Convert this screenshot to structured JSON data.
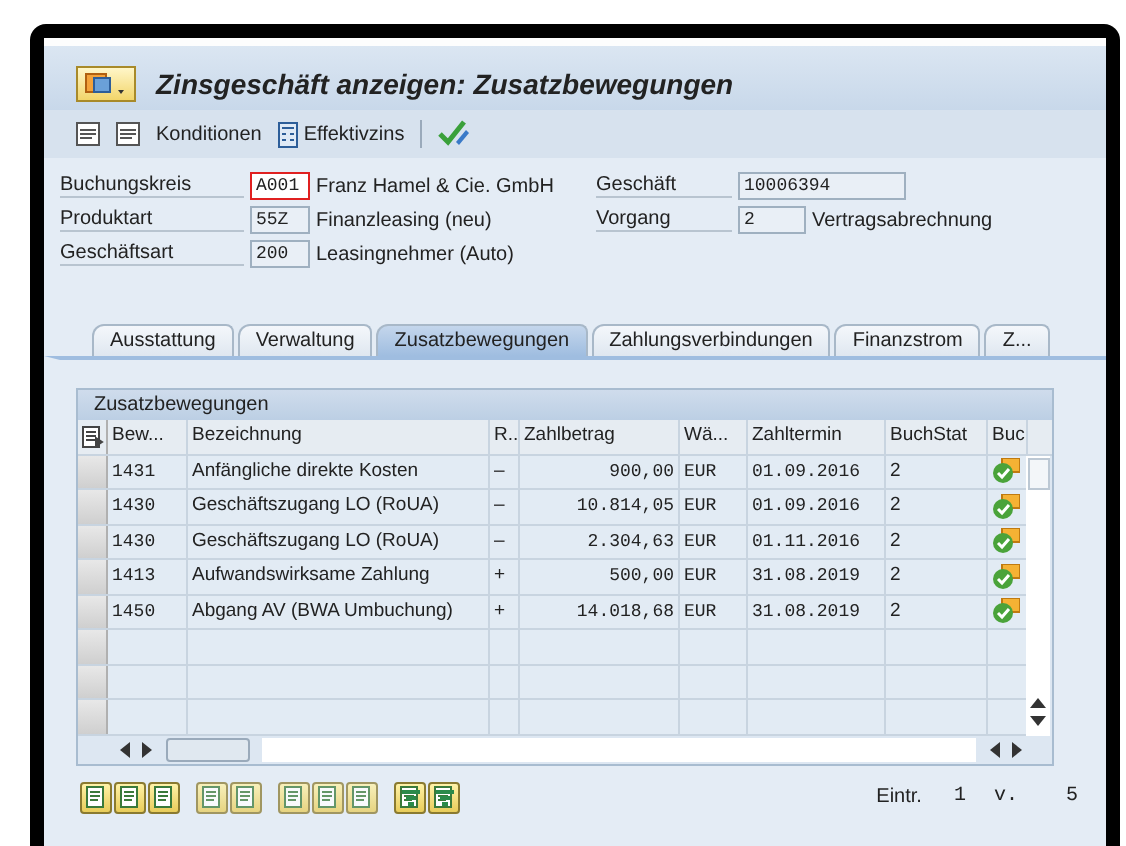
{
  "window": {
    "title": "Zinsgeschäft anzeigen: Zusatzbewegungen"
  },
  "toolbar": {
    "items": [
      {
        "kind": "icon"
      },
      {
        "kind": "icon"
      },
      {
        "kind": "text",
        "label": "Konditionen"
      },
      {
        "kind": "calc",
        "label": "Effektivzins"
      },
      {
        "kind": "check"
      }
    ]
  },
  "header": {
    "left": [
      {
        "label": "Buchungskreis",
        "value": "A001",
        "focused": true,
        "text": "Franz Hamel & Cie. GmbH"
      },
      {
        "label": "Produktart",
        "value": "55Z",
        "focused": false,
        "text": "Finanzleasing (neu)"
      },
      {
        "label": "Geschäftsart",
        "value": "200",
        "focused": false,
        "text": "Leasingnehmer (Auto)"
      }
    ],
    "right": [
      {
        "label": "Geschäft",
        "value": "10006394"
      },
      {
        "label": "Vorgang",
        "value": "2",
        "text": "Vertragsabrechnung"
      }
    ]
  },
  "tabs": [
    {
      "label": "Ausstattung",
      "selected": false
    },
    {
      "label": "Verwaltung",
      "selected": false
    },
    {
      "label": "Zusatzbewegungen",
      "selected": true
    },
    {
      "label": "Zahlungsverbindungen",
      "selected": false
    },
    {
      "label": "Finanzstrom",
      "selected": false
    },
    {
      "label": "Z...",
      "selected": false
    }
  ],
  "table": {
    "title": "Zusatzbewegungen",
    "columns": [
      "Bew...",
      "Bezeichnung",
      "R..",
      "Zahlbetrag",
      "Wä...",
      "Zahltermin",
      "BuchStat",
      "Buc"
    ],
    "rows": [
      [
        "1431",
        "Anfängliche direkte Kosten",
        "–",
        "900,00",
        "EUR",
        "01.09.2016",
        "2"
      ],
      [
        "1430",
        "Geschäftszugang LO (RoUA)",
        "–",
        "10.814,05",
        "EUR",
        "01.09.2016",
        "2"
      ],
      [
        "1430",
        "Geschäftszugang LO (RoUA)",
        "–",
        "2.304,63",
        "EUR",
        "01.11.2016",
        "2"
      ],
      [
        "1413",
        "Aufwandswirksame Zahlung",
        "+",
        "500,00",
        "EUR",
        "31.08.2019",
        "2"
      ],
      [
        "1450",
        "Abgang AV (BWA Umbuchung)",
        "+",
        "14.018,68",
        "EUR",
        "31.08.2019",
        "2"
      ]
    ]
  },
  "status": {
    "label": "Eintr.",
    "current": "1",
    "of": "v.",
    "total": "5"
  }
}
